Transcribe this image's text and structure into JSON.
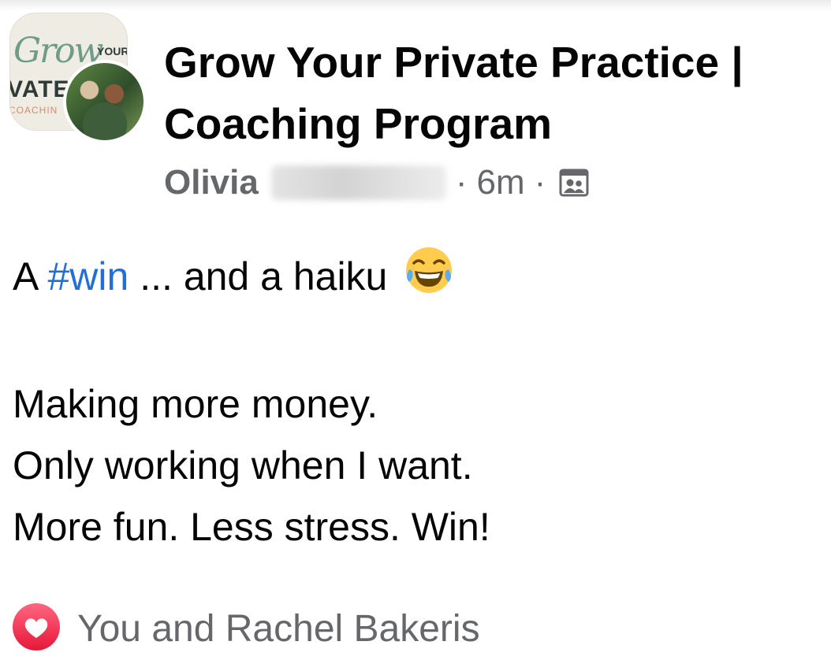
{
  "post": {
    "group_name": "Grow Your Private Practice | Coaching Program",
    "group_logo": {
      "script": "Grow",
      "your": "YOUR",
      "vate": "VATE",
      "coaching": "COACHIN"
    },
    "author_first_name": "Olivia",
    "dot": "·",
    "time_ago": "6m",
    "audience_icon": "group-members-icon",
    "text": {
      "prefix": "A",
      "hashtag": "#win",
      "suffix": "... and a haiku",
      "emoji": "joy-emoji"
    },
    "haiku_lines": [
      "Making more money.",
      "Only working when I want.",
      "More fun. Less stress. Win!"
    ]
  },
  "reactions": {
    "icon": "love-reaction-icon",
    "color": "#f33e58",
    "text": "You and Rachel Bakeris"
  },
  "colors": {
    "hashtag": "#216fdb",
    "meta": "#65676b"
  }
}
